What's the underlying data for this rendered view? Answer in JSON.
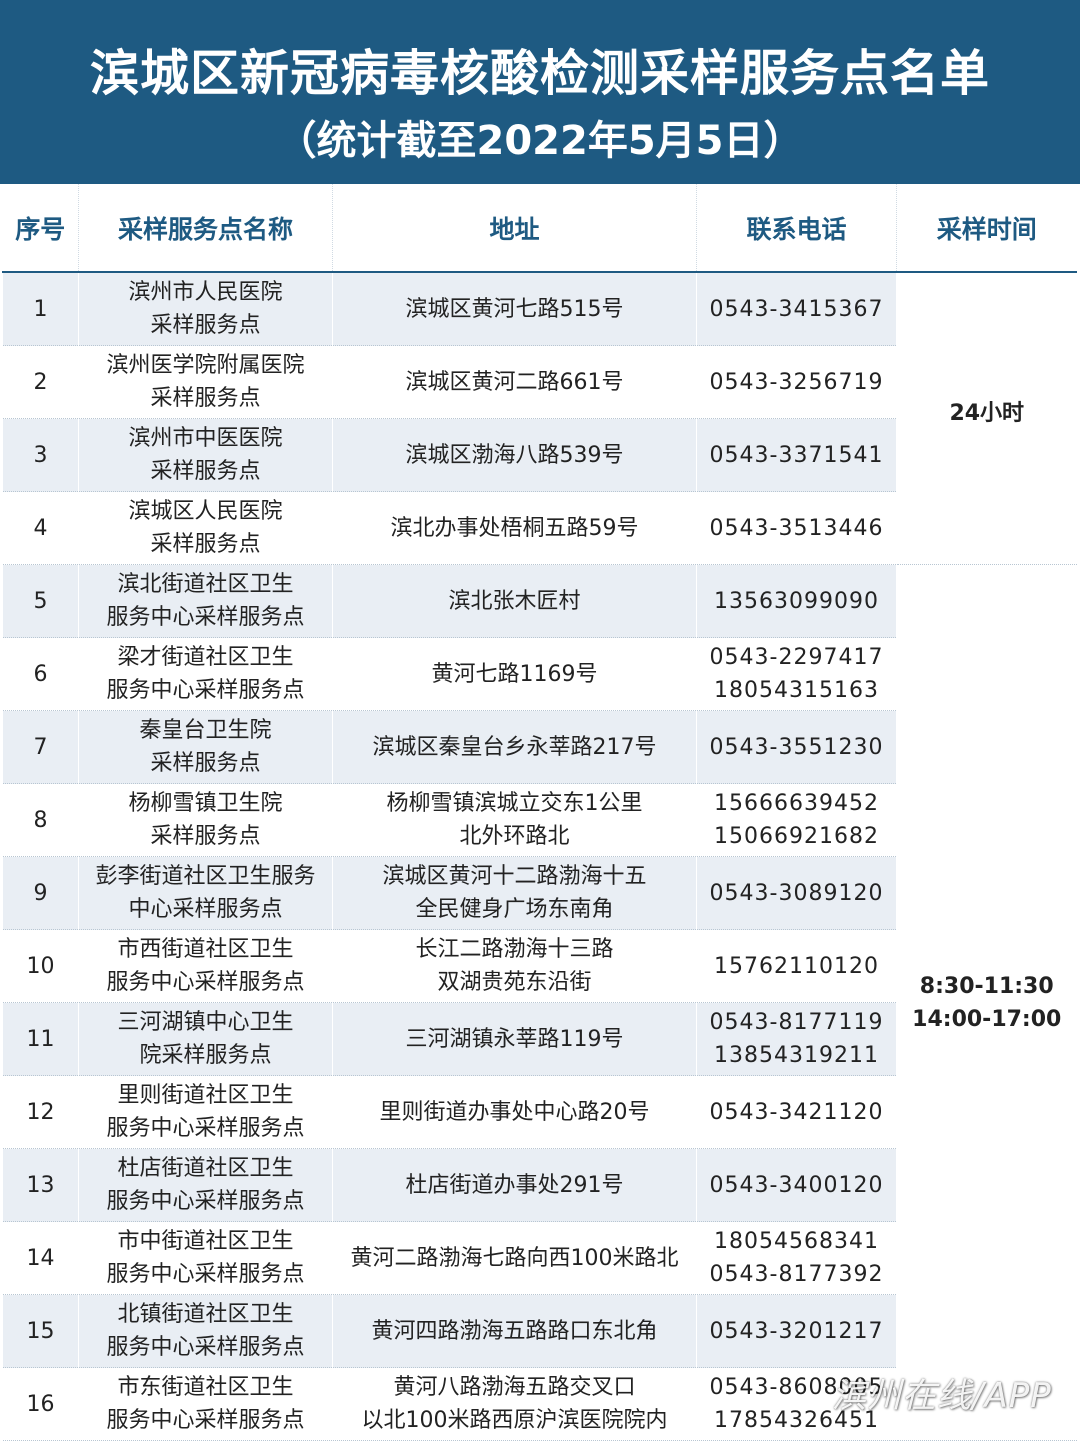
{
  "header": {
    "title": "滨城区新冠病毒核酸检测采样服务点名单",
    "subtitle": "（统计截至2022年5月5日）"
  },
  "columns": {
    "seq": "序号",
    "name": "采样服务点名称",
    "address": "地址",
    "phone": "联系电话",
    "time": "采样时间"
  },
  "rows": [
    {
      "seq": "1",
      "name1": "滨州市人民医院",
      "name2": "采样服务点",
      "address1": "滨城区黄河七路515号",
      "address2": "",
      "phone1": "0543-3415367",
      "phone2": ""
    },
    {
      "seq": "2",
      "name1": "滨州医学院附属医院",
      "name2": "采样服务点",
      "address1": "滨城区黄河二路661号",
      "address2": "",
      "phone1": "0543-3256719",
      "phone2": ""
    },
    {
      "seq": "3",
      "name1": "滨州市中医医院",
      "name2": "采样服务点",
      "address1": "滨城区渤海八路539号",
      "address2": "",
      "phone1": "0543-3371541",
      "phone2": ""
    },
    {
      "seq": "4",
      "name1": "滨城区人民医院",
      "name2": "采样服务点",
      "address1": "滨北办事处梧桐五路59号",
      "address2": "",
      "phone1": "0543-3513446",
      "phone2": ""
    },
    {
      "seq": "5",
      "name1": "滨北街道社区卫生",
      "name2": "服务中心采样服务点",
      "address1": "滨北张木匠村",
      "address2": "",
      "phone1": "13563099090",
      "phone2": ""
    },
    {
      "seq": "6",
      "name1": "梁才街道社区卫生",
      "name2": "服务中心采样服务点",
      "address1": "黄河七路1169号",
      "address2": "",
      "phone1": "0543-2297417",
      "phone2": "18054315163"
    },
    {
      "seq": "7",
      "name1": "秦皇台卫生院",
      "name2": "采样服务点",
      "address1": "滨城区秦皇台乡永莘路217号",
      "address2": "",
      "phone1": "0543-3551230",
      "phone2": ""
    },
    {
      "seq": "8",
      "name1": "杨柳雪镇卫生院",
      "name2": "采样服务点",
      "address1": "杨柳雪镇滨城立交东1公里",
      "address2": "北外环路北",
      "phone1": "15666639452",
      "phone2": "15066921682"
    },
    {
      "seq": "9",
      "name1": "彭李街道社区卫生服务",
      "name2": "中心采样服务点",
      "address1": "滨城区黄河十二路渤海十五",
      "address2": "全民健身广场东南角",
      "phone1": "0543-3089120",
      "phone2": ""
    },
    {
      "seq": "10",
      "name1": "市西街道社区卫生",
      "name2": "服务中心采样服务点",
      "address1": "长江二路渤海十三路",
      "address2": "双湖贵苑东沿街",
      "phone1": "15762110120",
      "phone2": ""
    },
    {
      "seq": "11",
      "name1": "三河湖镇中心卫生",
      "name2": "院采样服务点",
      "address1": "三河湖镇永莘路119号",
      "address2": "",
      "phone1": "0543-8177119",
      "phone2": "13854319211"
    },
    {
      "seq": "12",
      "name1": "里则街道社区卫生",
      "name2": "服务中心采样服务点",
      "address1": "里则街道办事处中心路20号",
      "address2": "",
      "phone1": "0543-3421120",
      "phone2": ""
    },
    {
      "seq": "13",
      "name1": "杜店街道社区卫生",
      "name2": "服务中心采样服务点",
      "address1": "杜店街道办事处291号",
      "address2": "",
      "phone1": "0543-3400120",
      "phone2": ""
    },
    {
      "seq": "14",
      "name1": "市中街道社区卫生",
      "name2": "服务中心采样服务点",
      "address1": "黄河二路渤海七路向西100米路北",
      "address2": "",
      "phone1": "18054568341",
      "phone2": "0543-8177392"
    },
    {
      "seq": "15",
      "name1": "北镇街道社区卫生",
      "name2": "服务中心采样服务点",
      "address1": "黄河四路渤海五路路口东北角",
      "address2": "",
      "phone1": "0543-3201217",
      "phone2": ""
    },
    {
      "seq": "16",
      "name1": "市东街道社区卫生",
      "name2": "服务中心采样服务点",
      "address1": "黄河八路渤海五路交叉口",
      "address2": "以北100米路西原沪滨医院院内",
      "phone1": "0543-8608005",
      "phone2": "17854326451"
    }
  ],
  "time_groups": {
    "group1": "24小时",
    "group2_line1": "8:30-11:30",
    "group2_line2": "14:00-17:00"
  },
  "watermark": "滨州在线/APP"
}
